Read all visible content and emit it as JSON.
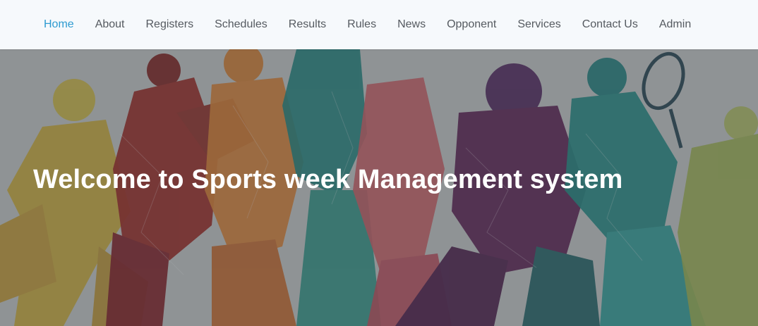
{
  "nav": {
    "items": [
      {
        "label": "Home",
        "active": true
      },
      {
        "label": "About",
        "active": false
      },
      {
        "label": "Registers",
        "active": false
      },
      {
        "label": "Schedules",
        "active": false
      },
      {
        "label": "Results",
        "active": false
      },
      {
        "label": "Rules",
        "active": false
      },
      {
        "label": "News",
        "active": false
      },
      {
        "label": "Opponent",
        "active": false
      },
      {
        "label": "Services",
        "active": false
      },
      {
        "label": "Contact Us",
        "active": false
      },
      {
        "label": "Admin",
        "active": false
      }
    ]
  },
  "hero": {
    "title": "Welcome to Sports week Management system",
    "background": "sports-athletes-illustration"
  },
  "colors": {
    "accent": "#2e9bd1",
    "nav_text": "#555a60",
    "nav_bg": "#f6f9fc",
    "hero_text": "#ffffff"
  }
}
